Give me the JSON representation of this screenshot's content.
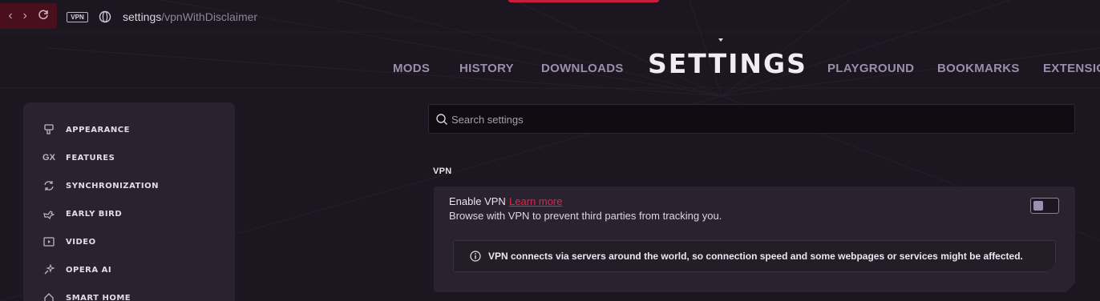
{
  "browser": {
    "vpn_badge": "VPN",
    "address_host": "settings",
    "address_path": "/vpnWithDisclaimer"
  },
  "tabs": [
    {
      "label": "MODS",
      "active": false
    },
    {
      "label": "HISTORY",
      "active": false
    },
    {
      "label": "DOWNLOADS",
      "active": false
    },
    {
      "label": "SETTINGS",
      "active": true
    },
    {
      "label": "PLAYGROUND",
      "active": false
    },
    {
      "label": "BOOKMARKS",
      "active": false
    },
    {
      "label": "EXTENSIO",
      "active": false
    }
  ],
  "sidebar": {
    "items": [
      {
        "label": "APPEARANCE",
        "icon": "brush-icon"
      },
      {
        "label": "FEATURES",
        "icon": "gx-icon",
        "icon_text": "GX"
      },
      {
        "label": "SYNCHRONIZATION",
        "icon": "sync-icon"
      },
      {
        "label": "EARLY BIRD",
        "icon": "bird-icon"
      },
      {
        "label": "VIDEO",
        "icon": "video-icon"
      },
      {
        "label": "OPERA AI",
        "icon": "sparkle-icon"
      },
      {
        "label": "SMART HOME",
        "icon": "home-icon"
      }
    ]
  },
  "search": {
    "placeholder": "Search settings",
    "value": ""
  },
  "vpn_section": {
    "title": "VPN",
    "enable_label": "Enable VPN",
    "learn_more": "Learn more",
    "description": "Browse with VPN to prevent third parties from tracking you.",
    "toggle_on": false,
    "notice": "VPN connects via servers around the world, so connection speed and some webpages or services might be affected."
  },
  "colors": {
    "accent": "#e0264a",
    "background": "#1b161f",
    "panel": "#2a232f"
  }
}
